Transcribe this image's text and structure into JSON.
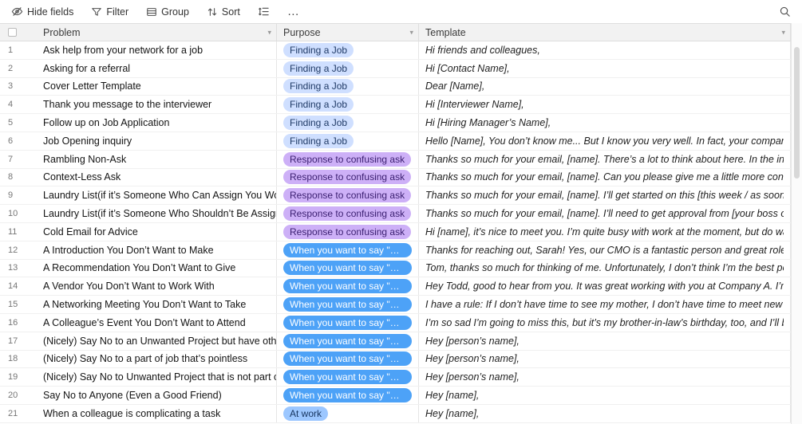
{
  "toolbar": {
    "hide_fields": "Hide fields",
    "filter": "Filter",
    "group": "Group",
    "sort": "Sort",
    "more": "…",
    "icons": [
      "eye-slash-icon",
      "funnel-icon",
      "group-rows-icon",
      "sort-arrows-icon",
      "row-height-icon",
      "ellipsis-icon",
      "search-icon"
    ]
  },
  "table": {
    "columns": [
      "Problem",
      "Purpose",
      "Template"
    ],
    "purpose_styles": {
      "Finding a Job": {
        "bg": "#cfdfff",
        "fg": "#1f3a66"
      },
      "Response to confusing ask": {
        "bg": "#cdb0f7",
        "fg": "#3a1e70"
      },
      "When you want to say \"No\"": {
        "bg": "#4da2f7",
        "fg": "#ffffff"
      },
      "At work": {
        "bg": "#9cc7ff",
        "fg": "#16345f"
      }
    },
    "rows": [
      {
        "num": "1",
        "problem": "Ask help from your network for a job",
        "purpose": "Finding a Job",
        "template": "Hi friends and colleagues,"
      },
      {
        "num": "2",
        "problem": "Asking for a referral",
        "purpose": "Finding a Job",
        "template": "Hi [Contact Name],"
      },
      {
        "num": "3",
        "problem": "Cover Letter Template",
        "purpose": "Finding a Job",
        "template": "Dear [Name],"
      },
      {
        "num": "4",
        "problem": "Thank you message to the interviewer",
        "purpose": "Finding a Job",
        "template": "Hi [Interviewer Name],"
      },
      {
        "num": "5",
        "problem": "Follow up on Job Application",
        "purpose": "Finding a Job",
        "template": "Hi [Hiring Manager’s Name],"
      },
      {
        "num": "6",
        "problem": "Job Opening inquiry",
        "purpose": "Finding a Job",
        "template": "Hello [Name], You don’t know me... But I know you very well. In fact, your company has been my care..."
      },
      {
        "num": "7",
        "problem": "Rambling Non-Ask",
        "purpose": "Response to confusing ask",
        "template": "Thanks so much for your email, [name]. There’s a lot to think about here. In the interest of getting bac..."
      },
      {
        "num": "8",
        "problem": "Context-Less Ask",
        "purpose": "Response to confusing ask",
        "template": "Thanks so much for your email, [name]. Can you please give me a little more context on the situation ..."
      },
      {
        "num": "9",
        "problem": "Laundry List(if it’s Someone Who Can Assign You Work)",
        "purpose": "Response to confusing ask",
        "template": "Thanks so much for your email, [name]. I’ll get started on this [this week / as soon as the new product..."
      },
      {
        "num": "10",
        "problem": "Laundry List(if it’s Someone Who Shouldn’t Be Assigning You Work)",
        "purpose": "Response to confusing ask",
        "template": "Thanks so much for your email, [name]. I’ll need to get approval from [your boss or another relevant s..."
      },
      {
        "num": "11",
        "problem": "Cold Email for Advice",
        "purpose": "Response to confusing ask",
        "template": "Hi [name], it’s nice to meet you. I’m quite busy with work at the moment, but do want to help and wou..."
      },
      {
        "num": "12",
        "problem": "A Introduction You Don’t Want to Make",
        "purpose": "When you want to say \"No\"",
        "template": "Thanks for reaching out, Sarah! Yes, our CMO is a fantastic person and great role model. Unfortunatel..."
      },
      {
        "num": "13",
        "problem": "A Recommendation You Don’t Want to Give",
        "purpose": "When you want to say \"No\"",
        "template": "Tom, thanks so much for thinking of me. Unfortunately, I don’t think I’m the best person to write your r..."
      },
      {
        "num": "14",
        "problem": "A Vendor You Don’t Want to Work With",
        "purpose": "When you want to say \"No\"",
        "template": "Hey Todd, good to hear from you. It was great working with you at Company A. I’m still getting a feel f..."
      },
      {
        "num": "15",
        "problem": "A Networking Meeting You Don’t Want to Take",
        "purpose": "When you want to say \"No\"",
        "template": "I have a rule: If I don’t have time to see my mother, I don’t have time to meet new people for coffee. A..."
      },
      {
        "num": "16",
        "problem": "A Colleague’s Event You Don’t Want to Attend",
        "purpose": "When you want to say \"No\"",
        "template": "I’m so sad I’m going to miss this, but it’s my brother-in-law’s birthday, too, and I’ll be blacklisted from ..."
      },
      {
        "num": "17",
        "problem": "(Nicely) Say No to an Unwanted Project but have other projects",
        "purpose": "When you want to say \"No\"",
        "template": "Hey [person’s name],"
      },
      {
        "num": "18",
        "problem": "(Nicely) Say No to a part of job that’s pointless",
        "purpose": "When you want to say \"No\"",
        "template": "Hey [person’s name],"
      },
      {
        "num": "19",
        "problem": "(Nicely) Say No to Unwanted Project that is not part of your job",
        "purpose": "When you want to say \"No\"",
        "template": "Hey [person’s name],"
      },
      {
        "num": "20",
        "problem": "Say No to Anyone (Even a Good Friend)",
        "purpose": "When you want to say \"No\"",
        "template": "Hey [name],"
      },
      {
        "num": "21",
        "problem": "When a colleague is complicating a task",
        "purpose": "At work",
        "template": "Hey [name],"
      }
    ]
  }
}
